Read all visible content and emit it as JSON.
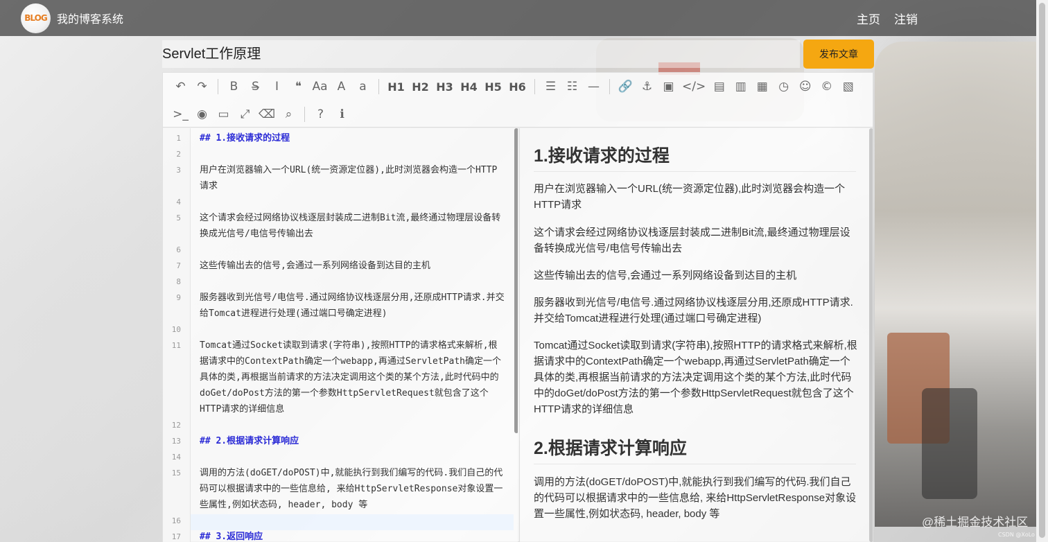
{
  "nav": {
    "logo_text": "BLOG",
    "site_title": "我的博客系统",
    "links": [
      "主页",
      "注销"
    ]
  },
  "article": {
    "title": "Servlet工作原理",
    "publish_label": "发布文章"
  },
  "toolbar": {
    "row1": [
      {
        "icon": "undo-icon",
        "glyph": "↶"
      },
      {
        "icon": "redo-icon",
        "glyph": "↷"
      },
      "sep",
      {
        "icon": "bold-icon",
        "glyph": "B"
      },
      {
        "icon": "strikethrough-icon",
        "glyph": "S̶"
      },
      {
        "icon": "italic-icon",
        "glyph": "I"
      },
      {
        "icon": "quote-icon",
        "glyph": "❝"
      },
      {
        "icon": "uppercase-icon",
        "glyph": "Aa"
      },
      {
        "icon": "uppercase-first-icon",
        "glyph": "A"
      },
      {
        "icon": "lowercase-icon",
        "glyph": "a"
      },
      "sep",
      {
        "icon": "h1-icon",
        "glyph": "H1"
      },
      {
        "icon": "h2-icon",
        "glyph": "H2"
      },
      {
        "icon": "h3-icon",
        "glyph": "H3"
      },
      {
        "icon": "h4-icon",
        "glyph": "H4"
      },
      {
        "icon": "h5-icon",
        "glyph": "H5"
      },
      {
        "icon": "h6-icon",
        "glyph": "H6"
      },
      "sep",
      {
        "icon": "unordered-list-icon",
        "glyph": "☰"
      },
      {
        "icon": "ordered-list-icon",
        "glyph": "☷"
      },
      {
        "icon": "horizontal-rule-icon",
        "glyph": "—"
      },
      "sep",
      {
        "icon": "link-icon",
        "glyph": "🔗"
      },
      {
        "icon": "anchor-icon",
        "glyph": "⚓"
      },
      {
        "icon": "image-icon",
        "glyph": "▣"
      },
      {
        "icon": "code-inline-icon",
        "glyph": "</>"
      },
      {
        "icon": "code-block-icon",
        "glyph": "▤"
      },
      {
        "icon": "preformatted-icon",
        "glyph": "▥"
      },
      {
        "icon": "table-icon",
        "glyph": "▦"
      },
      {
        "icon": "datetime-icon",
        "glyph": "◷"
      },
      {
        "icon": "emoji-icon",
        "glyph": "☺"
      },
      {
        "icon": "html-entities-icon",
        "glyph": "©"
      },
      {
        "icon": "pagebreak-icon",
        "glyph": "▧"
      }
    ],
    "row2": [
      {
        "icon": "goto-line-icon",
        "glyph": ">_"
      },
      {
        "icon": "watch-toggle-icon",
        "glyph": "◉"
      },
      {
        "icon": "preview-icon",
        "glyph": "▭"
      },
      {
        "icon": "fullscreen-icon",
        "glyph": "⤢"
      },
      {
        "icon": "clear-icon",
        "glyph": "⌫"
      },
      {
        "icon": "search-icon",
        "glyph": "⌕"
      },
      "sep",
      {
        "icon": "help-icon",
        "glyph": "?"
      },
      {
        "icon": "info-icon",
        "glyph": "ℹ"
      }
    ]
  },
  "editor": {
    "line_numbers": [
      "1",
      "2",
      "3",
      "4",
      "5",
      "6",
      "7",
      "8",
      "9",
      "10",
      "11",
      "12",
      "13",
      "14",
      "15",
      "16",
      "17"
    ],
    "lines": {
      "l1": "## 1.接收请求的过程",
      "l3": "用户在浏览器输入一个URL(统一资源定位器),此时浏览器会构造一个HTTP请求",
      "l5": "这个请求会经过网络协议栈逐层封装成二进制Bit流,最终通过物理层设备转换成光信号/电信号传输出去",
      "l7": "这些传输出去的信号,会通过一系列网络设备到达目的主机",
      "l9": "服务器收到光信号/电信号.通过网络协议栈逐层分用,还原成HTTP请求.并交给Tomcat进程进行处理(通过端口号确定进程)",
      "l11": "Tomcat通过Socket读取到请求(字符串),按照HTTP的请求格式来解析,根据请求中的ContextPath确定一个webapp,再通过ServletPath确定一个具体的类,再根据当前请求的方法决定调用这个类的某个方法,此时代码中的doGet/doPost方法的第一个参数HttpServletRequest就包含了这个HTTP请求的详细信息",
      "l13": "## 2.根据请求计算响应",
      "l15": "调用的方法(doGET/doPOST)中,就能执行到我们编写的代码.我们自己的代码可以根据请求中的一些信息给, 来给HttpServletResponse对象设置一些属性,例如状态码, header, body 等",
      "l17": "## 3.返回响应"
    }
  },
  "preview": {
    "h1": "1.接收请求的过程",
    "p1": "用户在浏览器输入一个URL(统一资源定位器),此时浏览器会构造一个HTTP请求",
    "p2": "这个请求会经过网络协议栈逐层封装成二进制Bit流,最终通过物理层设备转换成光信号/电信号传输出去",
    "p3": "这些传输出去的信号,会通过一系列网络设备到达目的主机",
    "p4": "服务器收到光信号/电信号.通过网络协议栈逐层分用,还原成HTTP请求.并交给Tomcat进程进行处理(通过端口号确定进程)",
    "p5": "Tomcat通过Socket读取到请求(字符串),按照HTTP的请求格式来解析,根据请求中的ContextPath确定一个webapp,再通过ServletPath确定一个具体的类,再根据当前请求的方法决定调用这个类的某个方法,此时代码中的doGet/doPost方法的第一个参数HttpServletRequest就包含了这个HTTP请求的详细信息",
    "h2": "2.根据请求计算响应",
    "p6": "调用的方法(doGET/doPOST)中,就能执行到我们编写的代码.我们自己的代码可以根据请求中的一些信息给, 来给HttpServletResponse对象设置一些属性,例如状态码, header, body 等"
  },
  "watermark": "@稀土掘金技术社区",
  "corner_mark": "CSDN @XoLo"
}
